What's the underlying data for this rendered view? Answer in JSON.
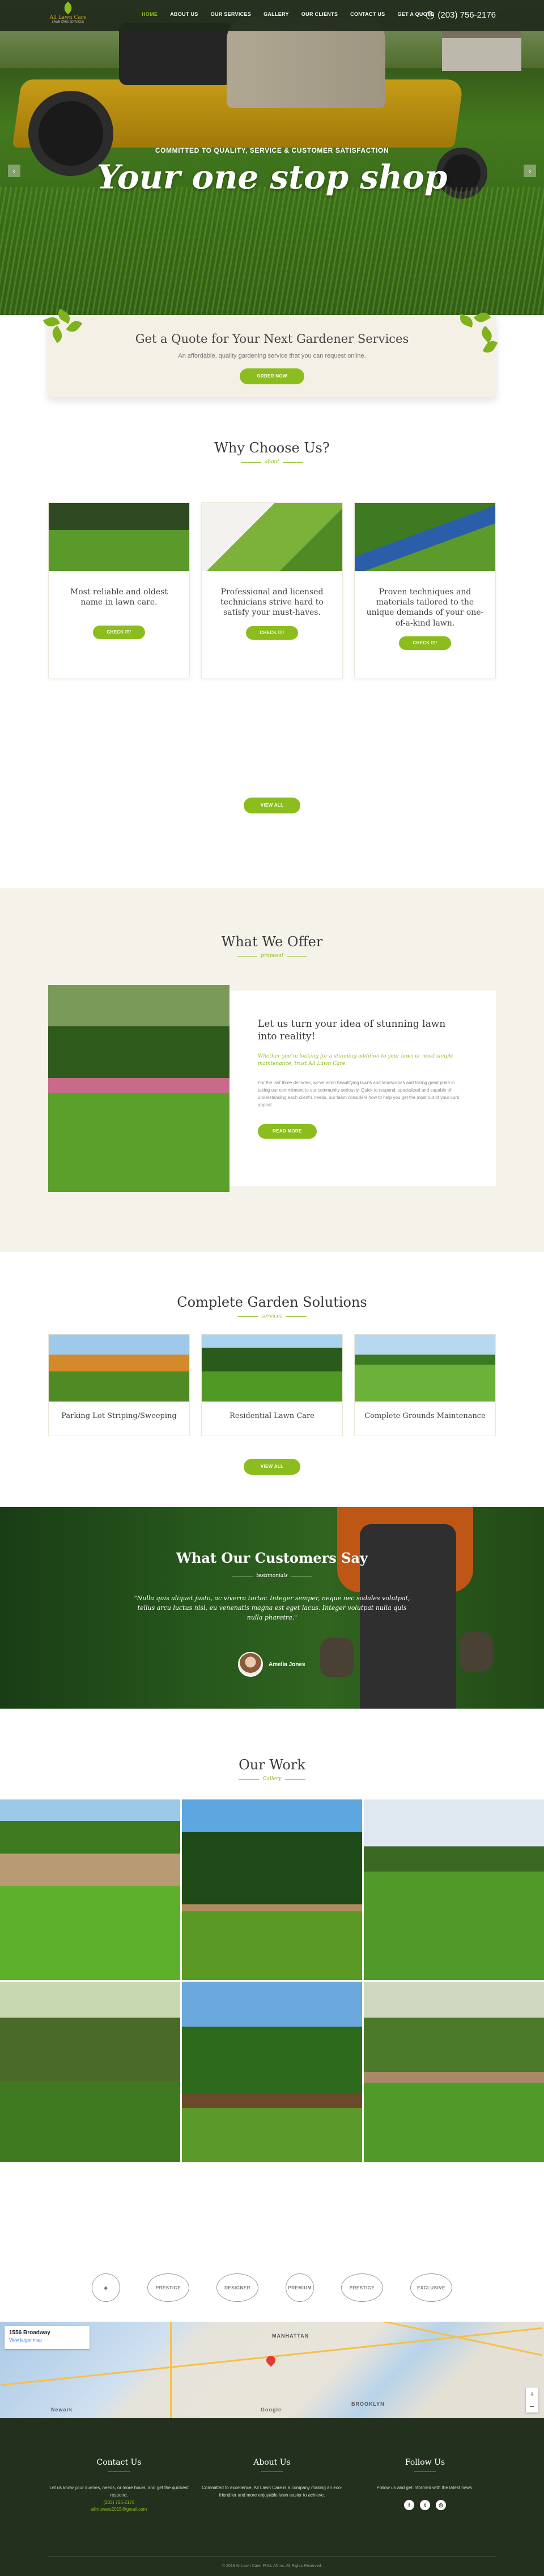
{
  "brand": {
    "name": "All Lawn Care",
    "tagline": "LAWN CARE SERVICES",
    "accent": "#8cbd1e",
    "dark": "#23301e"
  },
  "nav": {
    "items": [
      "HOME",
      "ABOUT US",
      "OUR SERVICES",
      "GALLERY",
      "OUR CLIENTS",
      "CONTACT US",
      "GET A QUOTE"
    ],
    "active": "HOME",
    "phone": "(203) 756-2176",
    "phone_icon": "phone-icon"
  },
  "hero": {
    "kicker": "COMMITTED TO QUALITY, SERVICE & CUSTOMER SATISFACTION",
    "headline": "Your one stop shop",
    "prev": "‹",
    "next": "›"
  },
  "quote": {
    "title": "Get a Quote for Your Next Gardener Services",
    "subtitle": "An affordable, quality gardening service that you can request online.",
    "button": "ORDER NOW"
  },
  "why": {
    "title": "Why Choose Us?",
    "sub": "about",
    "cards": [
      {
        "text": "Most reliable and oldest name in lawn care.",
        "button": "CHECK IT!"
      },
      {
        "text": "Professional and licensed technicians strive hard to satisfy your must-haves.",
        "button": "CHECK IT!"
      },
      {
        "text": "Proven techniques and materials tailored to the unique demands of your one-of-a-kind lawn.",
        "button": "CHECK IT!"
      }
    ],
    "view_all": "VIEW ALL"
  },
  "offer": {
    "title": "What We Offer",
    "sub": "proposal",
    "heading": "Let us turn your idea of stunning lawn into reality!",
    "emphasis": "Whether you're looking for a stunning addition to your lawn or need simple maintenance, trust All Lawn Care.",
    "body": "For the last three decades, we've been beautifying lawns and landscapes and taking great pride in taking our commitment to our community seriously. Quick to respond, specialized and capable of understanding each client's needs, our team considers how to help you get the most out of your curb appeal.",
    "button": "READ MORE"
  },
  "services": {
    "title": "Complete Garden Solutions",
    "sub": "services",
    "items": [
      "Parking Lot Striping/Sweeping",
      "Residential Lawn Care",
      "Complete Grounds Maintenance"
    ],
    "view_all": "VIEW ALL"
  },
  "testimonials": {
    "title": "What Our Customers Say",
    "sub": "testimonials",
    "quote": "\"Nulla quis aliquet justo, ac viverra tortor. Integer semper, neque nec sodales volutpat, tellus arcu luctus nisl, eu venenatis magna est eget lacus. Integer volutpat nulla quis nulla pharetra.\"",
    "author": "Amelia Jones"
  },
  "work": {
    "title": "Our Work",
    "sub": "Gallery"
  },
  "partners": [
    "PRESTIGE",
    "DESIGNER",
    "PREMIUM",
    "PRESTIGE",
    "EXCLUSIVE"
  ],
  "map": {
    "address": "1556 Broadway",
    "link": "View larger map",
    "labels": [
      "MANHATTAN",
      "BROOKLYN",
      "Newark",
      "Google"
    ]
  },
  "footer": {
    "contact": {
      "title": "Contact Us",
      "text": "Let us know your queries, needs, or more hours, and get the quickest respond.",
      "phone": "(203) 756-2176",
      "email": "allmowers2015@gmail.com"
    },
    "about": {
      "title": "About Us",
      "text": "Committed to excellence, All Lawn Care is a company making an eco-friendlier and more enjoyable lawn easier to achieve."
    },
    "follow": {
      "title": "Follow Us",
      "text": "Follow us and get informed with the latest news.",
      "icons": [
        "facebook-icon",
        "twitter-icon",
        "instagram-icon"
      ],
      "glyphs": [
        "f",
        "t",
        "◎"
      ]
    },
    "copyright": "© 2019 All Lawn Care. FULL All Inc. All Rights Reserved."
  }
}
